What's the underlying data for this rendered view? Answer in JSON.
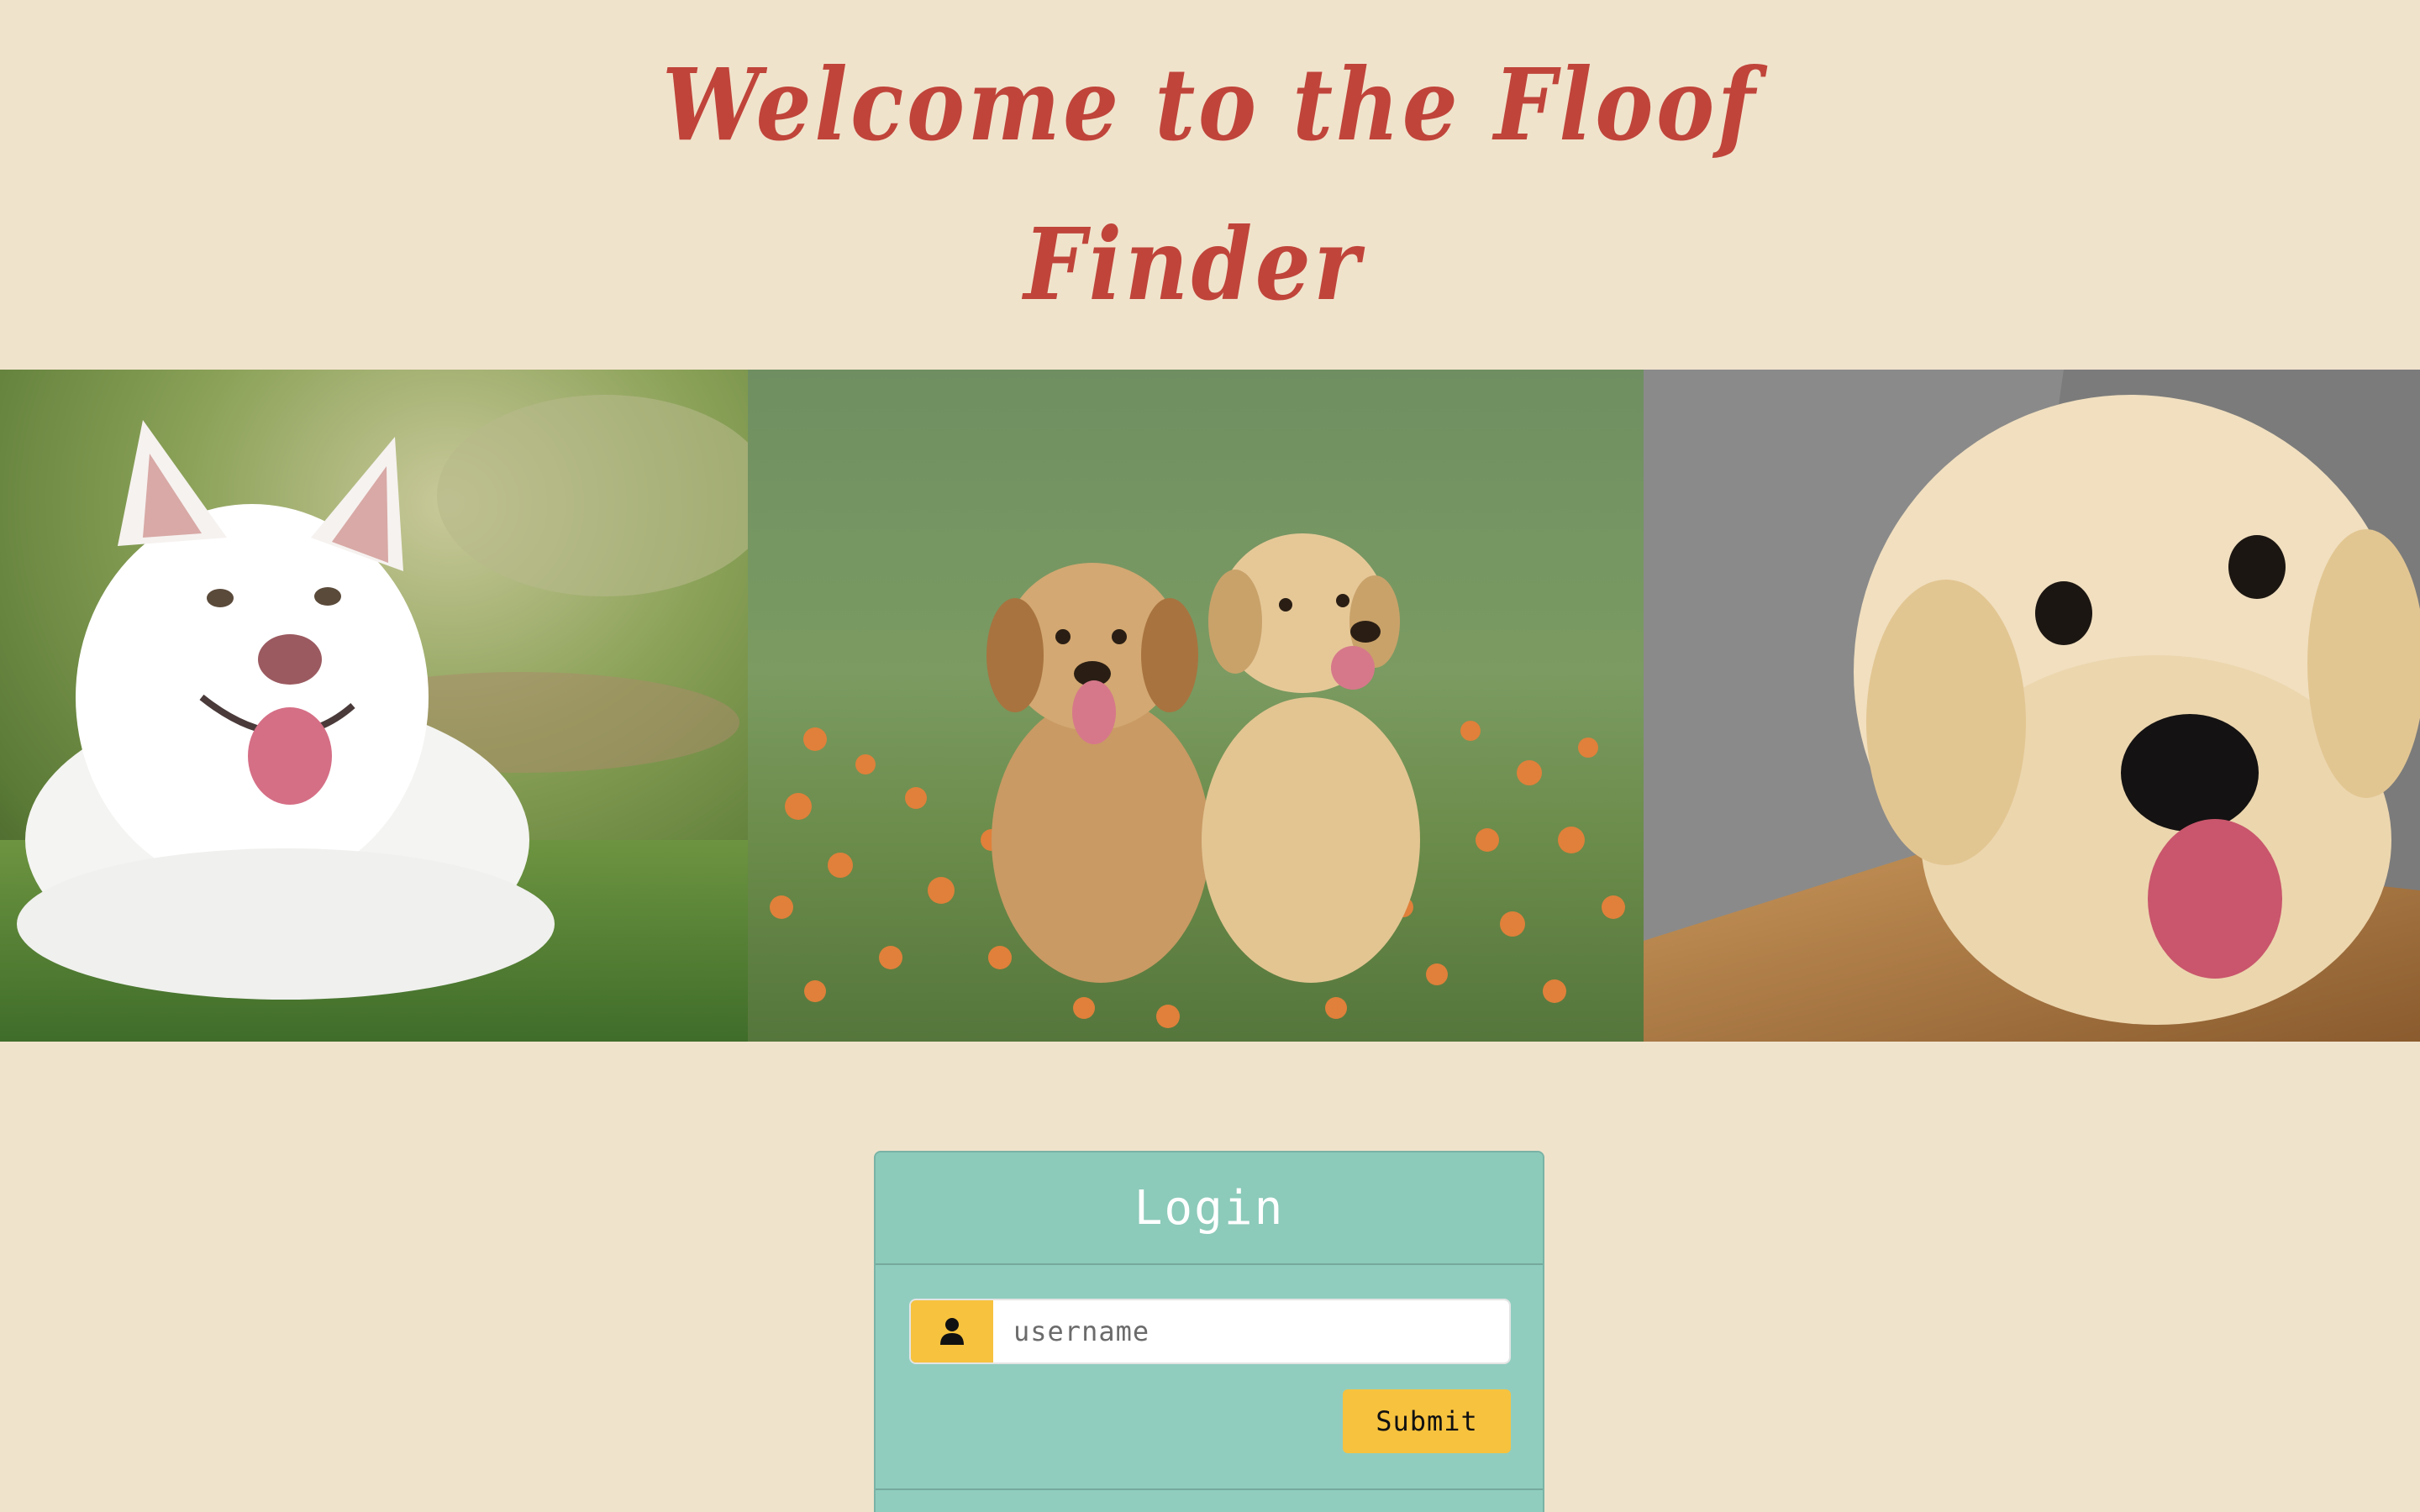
{
  "header": {
    "title_line_1": "Welcome to the Floof",
    "title_line_2": "Finder"
  },
  "photos": [
    {
      "name": "white fluffy dog lying on grass"
    },
    {
      "name": "two golden puppies sitting in flowers"
    },
    {
      "name": "cream puppy close-up"
    }
  ],
  "login": {
    "title": "Login",
    "username_placeholder": "username",
    "username_value": "",
    "user_icon": "user-icon",
    "submit_label": "Submit"
  },
  "colors": {
    "background": "#f0e3cc",
    "title": "#c0443a",
    "card": "#90cdbf",
    "accent": "#f7c23e"
  }
}
